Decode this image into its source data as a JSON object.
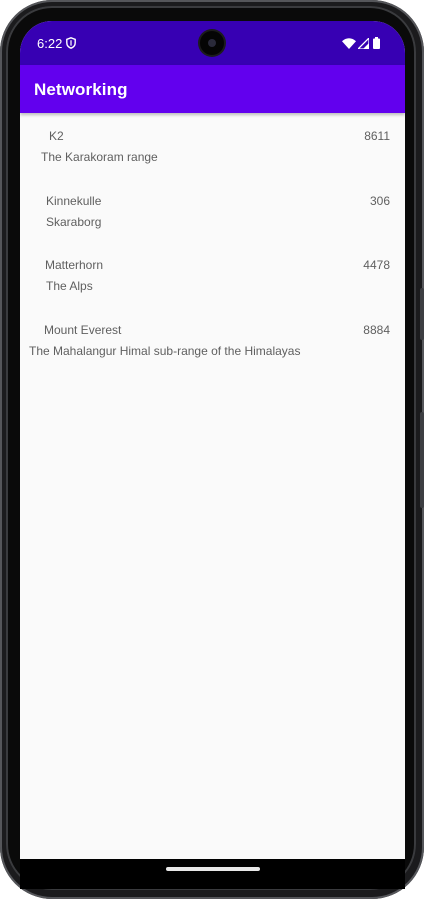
{
  "status_bar": {
    "time": "6:22",
    "background": "#3700b3"
  },
  "app_bar": {
    "title": "Networking",
    "background": "#6200ee"
  },
  "mountains": [
    {
      "name": "K2",
      "height": "8611",
      "range": "The Karakoram range"
    },
    {
      "name": "Kinnekulle",
      "height": "306",
      "range": "Skaraborg"
    },
    {
      "name": "Matterhorn",
      "height": "4478",
      "range": "The Alps"
    },
    {
      "name": "Mount Everest",
      "height": "8884",
      "range": "The Mahalangur Himal sub-range of the Himalayas"
    }
  ],
  "icons": {
    "status": [
      "shield-icon",
      "wifi-icon",
      "signal-icon",
      "battery-icon"
    ]
  }
}
